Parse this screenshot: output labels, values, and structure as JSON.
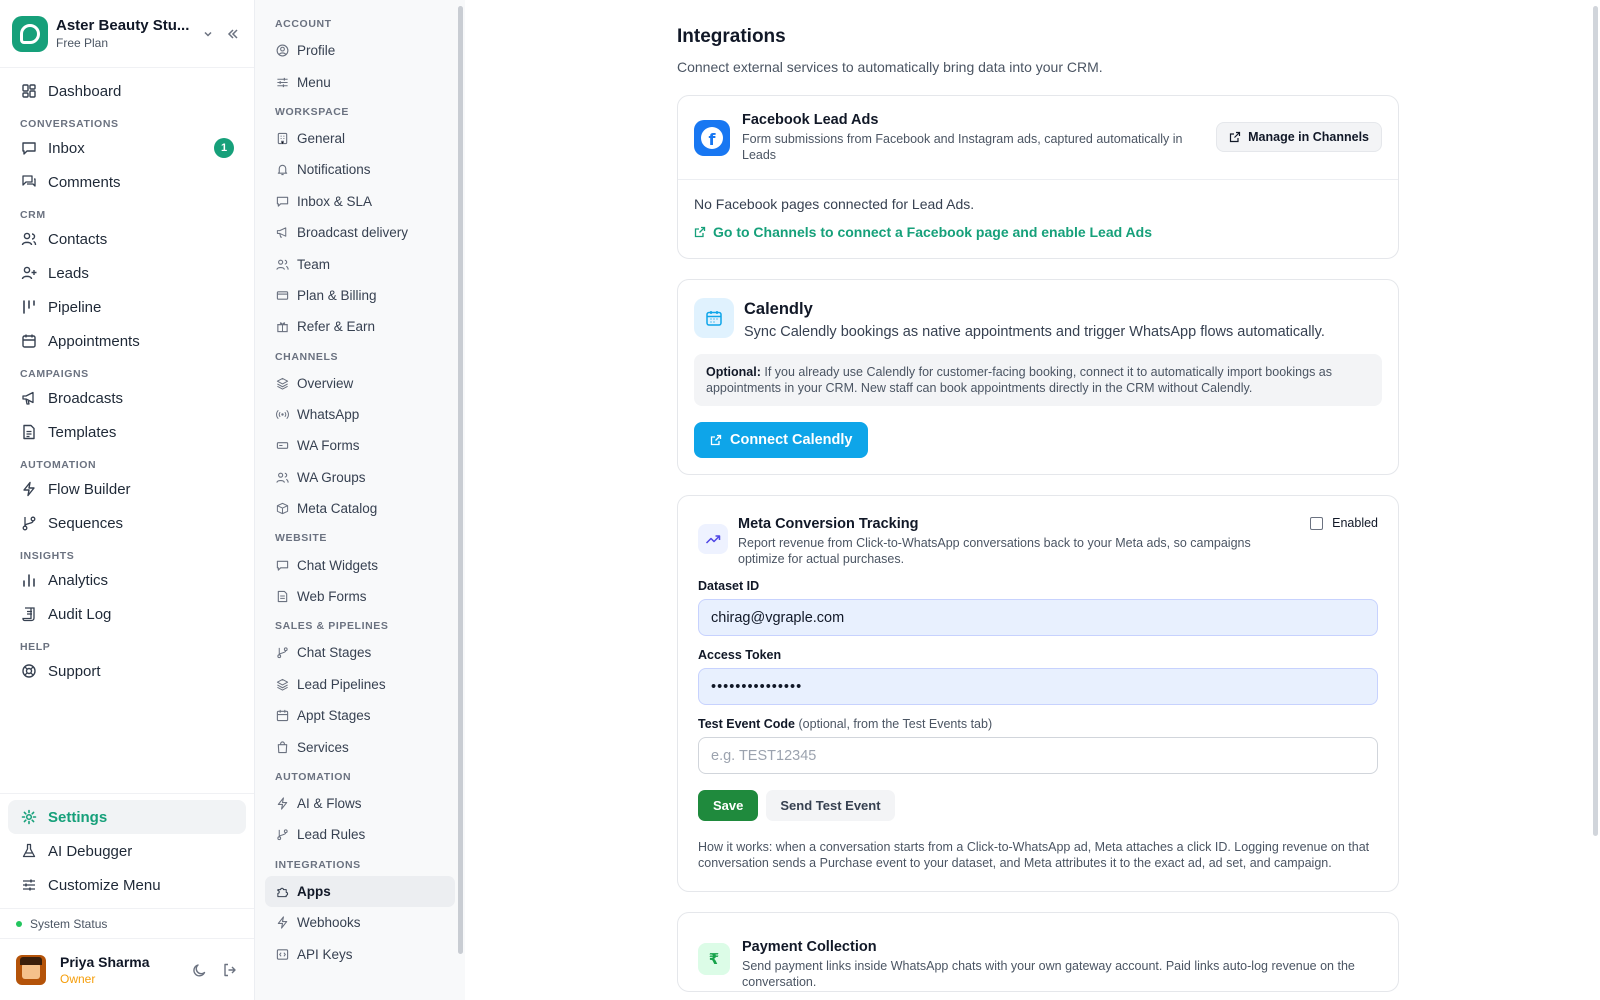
{
  "workspace": {
    "name": "Aster Beauty Stu...",
    "plan": "Free Plan"
  },
  "sidebar": {
    "dashboard": "Dashboard",
    "sections": [
      {
        "title": "CONVERSATIONS",
        "items": [
          {
            "label": "Inbox",
            "badge": "1"
          },
          {
            "label": "Comments"
          }
        ]
      },
      {
        "title": "CRM",
        "items": [
          {
            "label": "Contacts"
          },
          {
            "label": "Leads"
          },
          {
            "label": "Pipeline"
          },
          {
            "label": "Appointments"
          }
        ]
      },
      {
        "title": "CAMPAIGNS",
        "items": [
          {
            "label": "Broadcasts"
          },
          {
            "label": "Templates"
          }
        ]
      },
      {
        "title": "AUTOMATION",
        "items": [
          {
            "label": "Flow Builder"
          },
          {
            "label": "Sequences"
          }
        ]
      },
      {
        "title": "INSIGHTS",
        "items": [
          {
            "label": "Analytics"
          },
          {
            "label": "Audit Log"
          }
        ]
      },
      {
        "title": "HELP",
        "items": [
          {
            "label": "Support"
          }
        ]
      }
    ],
    "bottom": [
      {
        "label": "Settings"
      },
      {
        "label": "AI Debugger"
      },
      {
        "label": "Customize Menu"
      }
    ],
    "system_status": "System Status",
    "user": {
      "name": "Priya Sharma",
      "role": "Owner"
    }
  },
  "settings_nav": {
    "sections": [
      {
        "title": "ACCOUNT",
        "items": [
          "Profile",
          "Menu"
        ]
      },
      {
        "title": "WORKSPACE",
        "items": [
          "General",
          "Notifications",
          "Inbox & SLA",
          "Broadcast delivery",
          "Team",
          "Plan & Billing",
          "Refer & Earn"
        ]
      },
      {
        "title": "CHANNELS",
        "items": [
          "Overview",
          "WhatsApp",
          "WA Forms",
          "WA Groups",
          "Meta Catalog"
        ]
      },
      {
        "title": "WEBSITE",
        "items": [
          "Chat Widgets",
          "Web Forms"
        ]
      },
      {
        "title": "SALES & PIPELINES",
        "items": [
          "Chat Stages",
          "Lead Pipelines",
          "Appt Stages",
          "Services"
        ]
      },
      {
        "title": "AUTOMATION",
        "items": [
          "AI & Flows",
          "Lead Rules"
        ]
      },
      {
        "title": "INTEGRATIONS",
        "items": [
          "Apps",
          "Webhooks",
          "API Keys"
        ]
      }
    ]
  },
  "page": {
    "title": "Integrations",
    "subtitle": "Connect external services to automatically bring data into your CRM."
  },
  "facebook": {
    "title": "Facebook Lead Ads",
    "description": "Form submissions from Facebook and Instagram ads, captured automatically in Leads",
    "manage_label": "Manage in Channels",
    "empty": "No Facebook pages connected for Lead Ads.",
    "link": "Go to Channels to connect a Facebook page and enable Lead Ads"
  },
  "calendly": {
    "title": "Calendly",
    "description": "Sync Calendly bookings as native appointments and trigger WhatsApp flows automatically.",
    "note_label": "Optional:",
    "note": "If you already use Calendly for customer-facing booking, connect it to automatically import bookings as appointments in your CRM. New staff can book appointments directly in the CRM without Calendly.",
    "button": "Connect Calendly"
  },
  "meta": {
    "title": "Meta Conversion Tracking",
    "description": "Report revenue from Click-to-WhatsApp conversations back to your Meta ads, so campaigns optimize for actual purchases.",
    "enabled_label": "Enabled",
    "dataset_label": "Dataset ID",
    "dataset_value": "chirag@vgraple.com",
    "token_label": "Access Token",
    "token_value": "•••••••••••••••",
    "test_label": "Test Event Code",
    "test_hint": "(optional, from the Test Events tab)",
    "test_placeholder": "e.g. TEST12345",
    "save": "Save",
    "send_test": "Send Test Event",
    "how": "How it works: when a conversation starts from a Click-to-WhatsApp ad, Meta attaches a click ID. Logging revenue on that conversation sends a Purchase event to your dataset, and Meta attributes it to the exact ad, ad set, and campaign."
  },
  "payment": {
    "title": "Payment Collection",
    "description": "Send payment links inside WhatsApp chats with your own gateway account. Paid links auto-log revenue on the conversation."
  },
  "colors": {
    "accent": "#16a07a",
    "calendly": "#0ea5e9",
    "facebook": "#1877f2",
    "save": "#1f8a3d"
  }
}
